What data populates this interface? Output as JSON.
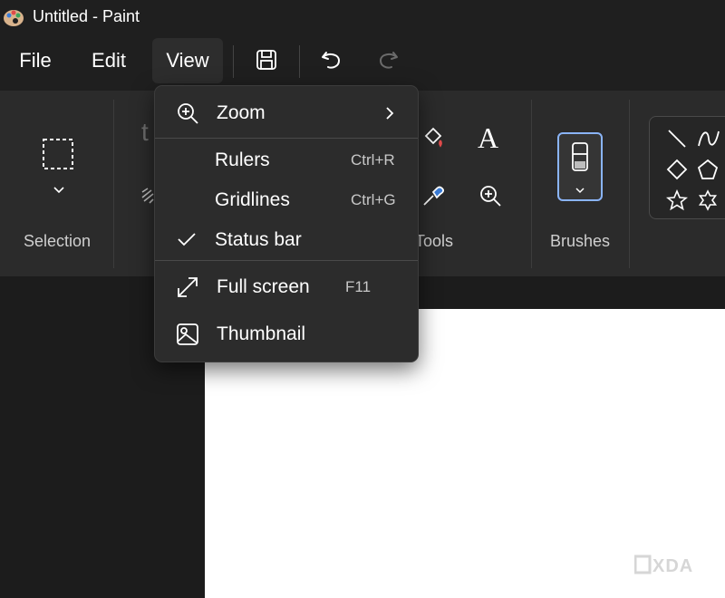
{
  "window": {
    "title": "Untitled - Paint"
  },
  "menubar": {
    "file": "File",
    "edit": "Edit",
    "view": "View"
  },
  "toolbar": {
    "icons": [
      "save-icon",
      "undo-icon",
      "redo-icon"
    ]
  },
  "ribbon": {
    "selection_label": "Selection",
    "tools_label": "Tools",
    "brushes_label": "Brushes",
    "text_partial": "t"
  },
  "view_menu": {
    "zoom": {
      "label": "Zoom"
    },
    "rulers": {
      "label": "Rulers",
      "shortcut": "Ctrl+R"
    },
    "gridlines": {
      "label": "Gridlines",
      "shortcut": "Ctrl+G"
    },
    "status_bar": {
      "label": "Status bar",
      "checked": true
    },
    "full_screen": {
      "label": "Full screen",
      "shortcut": "F11"
    },
    "thumbnail": {
      "label": "Thumbnail"
    }
  },
  "watermark": "XDA",
  "colors": {
    "background": "#1f1f1f",
    "ribbon": "#2b2b2b",
    "menu": "#2c2c2c",
    "accent": "#8ab4f8"
  }
}
